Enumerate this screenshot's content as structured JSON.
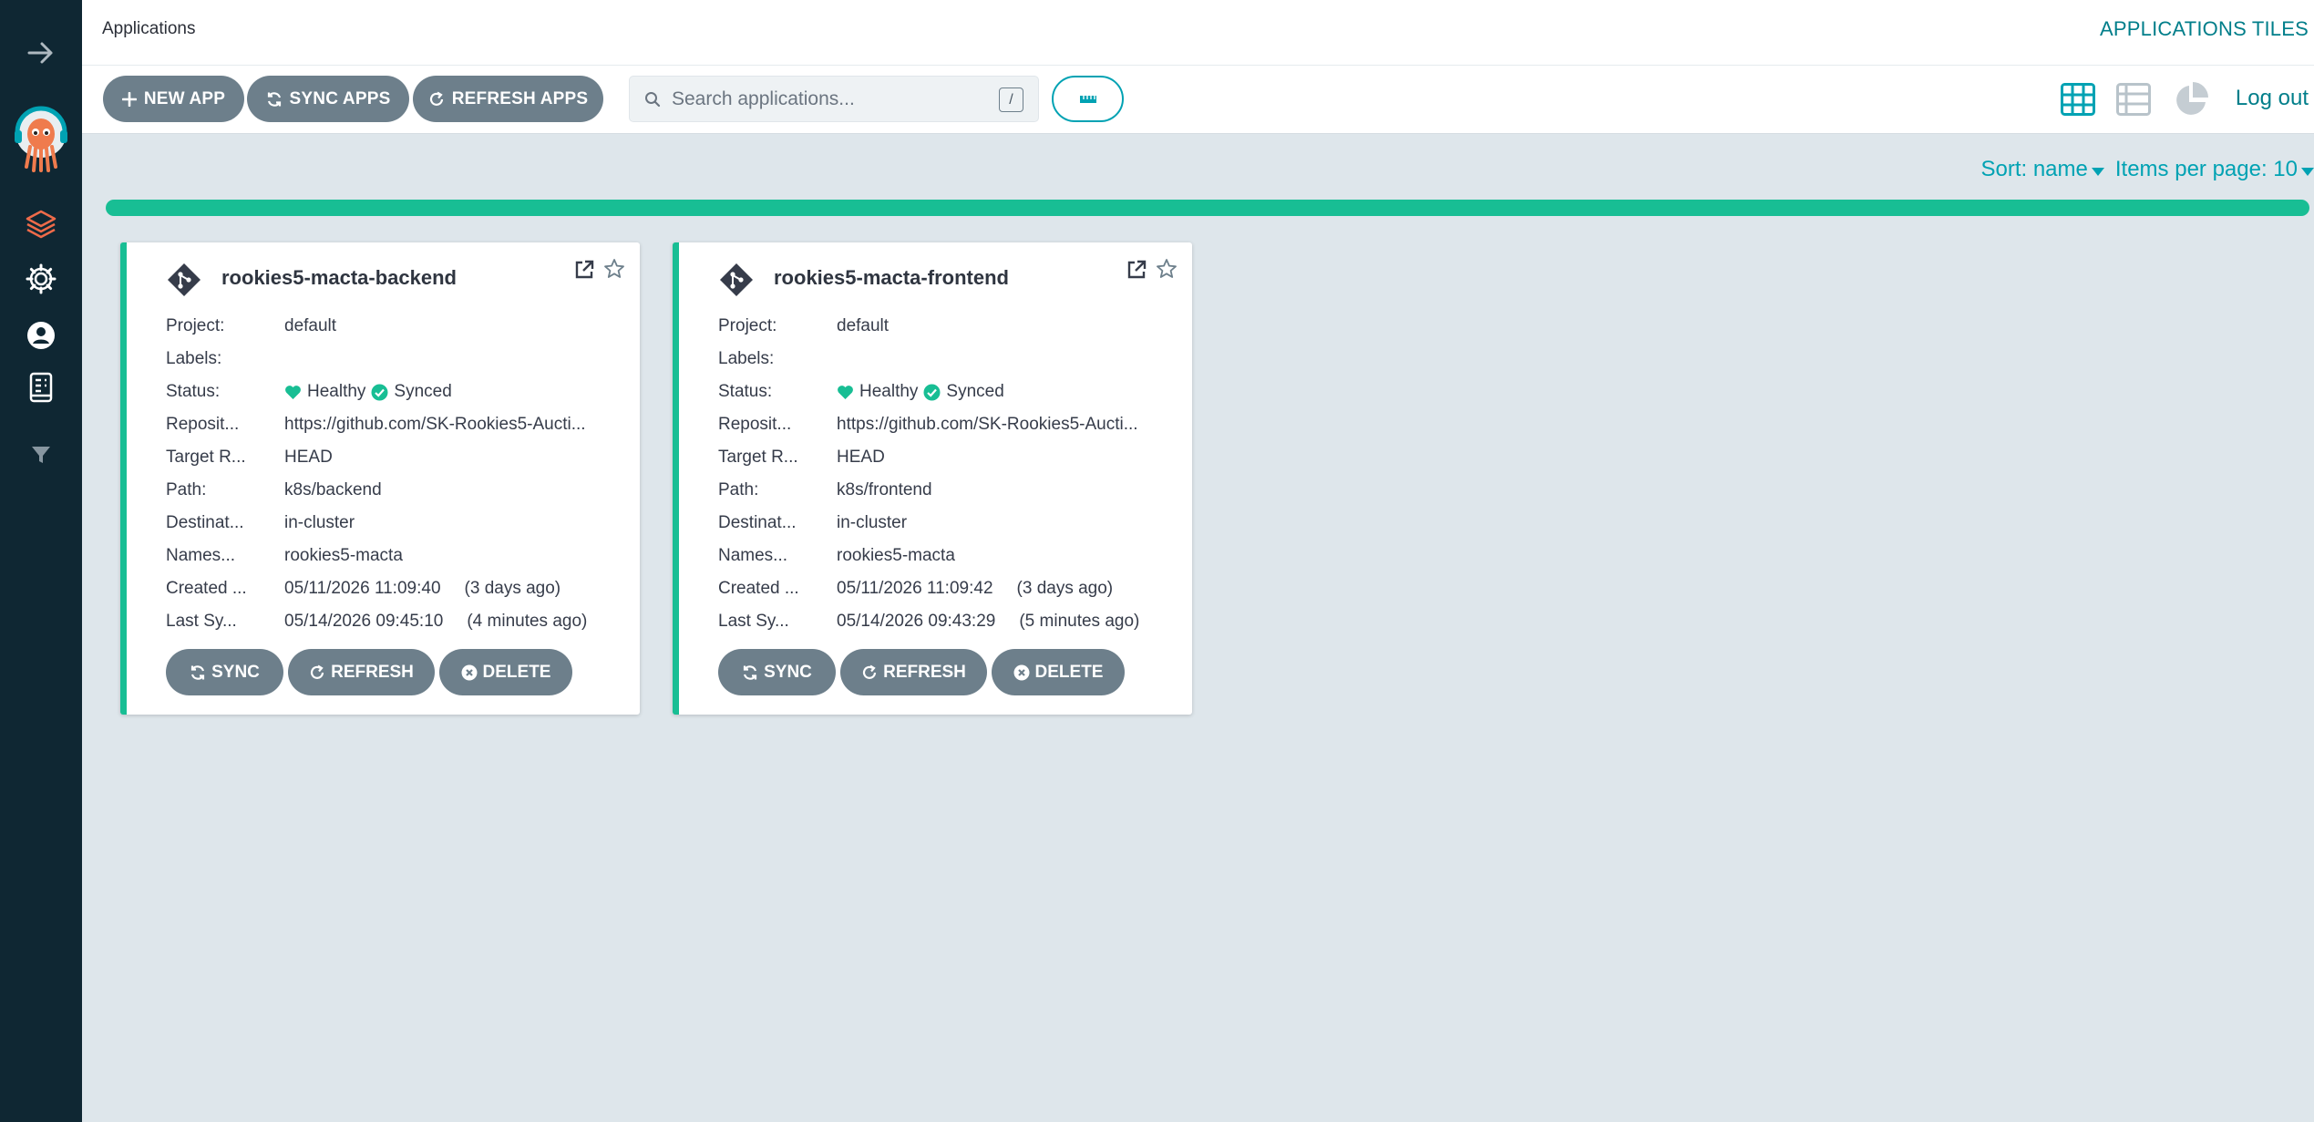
{
  "header": {
    "title": "Applications",
    "page_label": "APPLICATIONS TILES"
  },
  "toolbar": {
    "new_app": "NEW APP",
    "sync_apps": "SYNC APPS",
    "refresh_apps": "REFRESH APPS",
    "search_placeholder": "Search applications...",
    "search_shortcut": "/",
    "logout": "Log out"
  },
  "sort": {
    "sort_label": "Sort: name",
    "items_label": "Items per page: 10"
  },
  "colors": {
    "sidebar": "#0f2733",
    "accent": "#00a2b3",
    "healthy": "#18be94",
    "button": "#6d7f8b"
  },
  "labels": {
    "project": "Project:",
    "labels": "Labels:",
    "status": "Status:",
    "repo": "Reposit...",
    "target": "Target R...",
    "path": "Path:",
    "destination": "Destinat...",
    "namespace": "Names...",
    "created": "Created ...",
    "last_sync": "Last Sy...",
    "sync": "SYNC",
    "refresh": "REFRESH",
    "delete": "DELETE"
  },
  "apps": [
    {
      "name": "rookies5-macta-backend",
      "project": "default",
      "labels": "",
      "health": "Healthy",
      "sync_status": "Synced",
      "repo": "https://github.com/SK-Rookies5-Aucti...",
      "target": "HEAD",
      "path": "k8s/backend",
      "destination": "in-cluster",
      "namespace": "rookies5-macta",
      "created": "05/11/2026 11:09:40",
      "created_ago": "(3 days ago)",
      "last_sync": "05/14/2026 09:45:10",
      "last_sync_ago": "(4 minutes ago)"
    },
    {
      "name": "rookies5-macta-frontend",
      "project": "default",
      "labels": "",
      "health": "Healthy",
      "sync_status": "Synced",
      "repo": "https://github.com/SK-Rookies5-Aucti...",
      "target": "HEAD",
      "path": "k8s/frontend",
      "destination": "in-cluster",
      "namespace": "rookies5-macta",
      "created": "05/11/2026 11:09:42",
      "created_ago": "(3 days ago)",
      "last_sync": "05/14/2026 09:43:29",
      "last_sync_ago": "(5 minutes ago)"
    }
  ]
}
